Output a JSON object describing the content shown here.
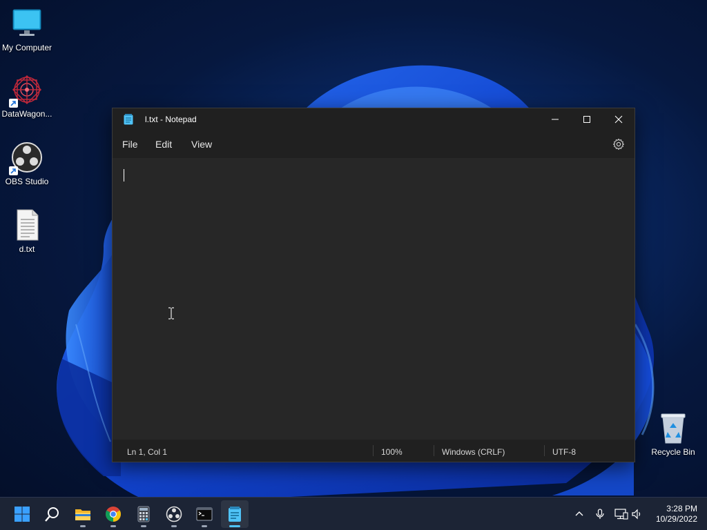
{
  "desktop": {
    "icons": [
      {
        "label": "My Computer",
        "icon": "monitor-icon"
      },
      {
        "label": "DataWagon...",
        "icon": "datawagon-icon"
      },
      {
        "label": "OBS Studio",
        "icon": "obs-icon"
      },
      {
        "label": "d.txt",
        "icon": "text-file-icon"
      },
      {
        "label": "Recycle Bin",
        "icon": "recycle-bin-icon"
      }
    ]
  },
  "window": {
    "title": "l.txt - Notepad",
    "menu": [
      "File",
      "Edit",
      "View"
    ],
    "editor_text": "",
    "status": {
      "position": "Ln 1, Col 1",
      "zoom": "100%",
      "line_endings": "Windows (CRLF)",
      "encoding": "UTF-8"
    }
  },
  "taskbar": {
    "apps": [
      "start",
      "search",
      "file-explorer",
      "chrome",
      "calculator",
      "obs",
      "terminal",
      "notepad"
    ],
    "active_app": "notepad",
    "clock": {
      "time": "3:28 PM",
      "date": "10/29/2022"
    }
  },
  "colors": {
    "accent": "#4fc3f7",
    "window_bg": "#272727",
    "titlebar_bg": "#202020",
    "taskbar_bg": "#1c2435"
  }
}
